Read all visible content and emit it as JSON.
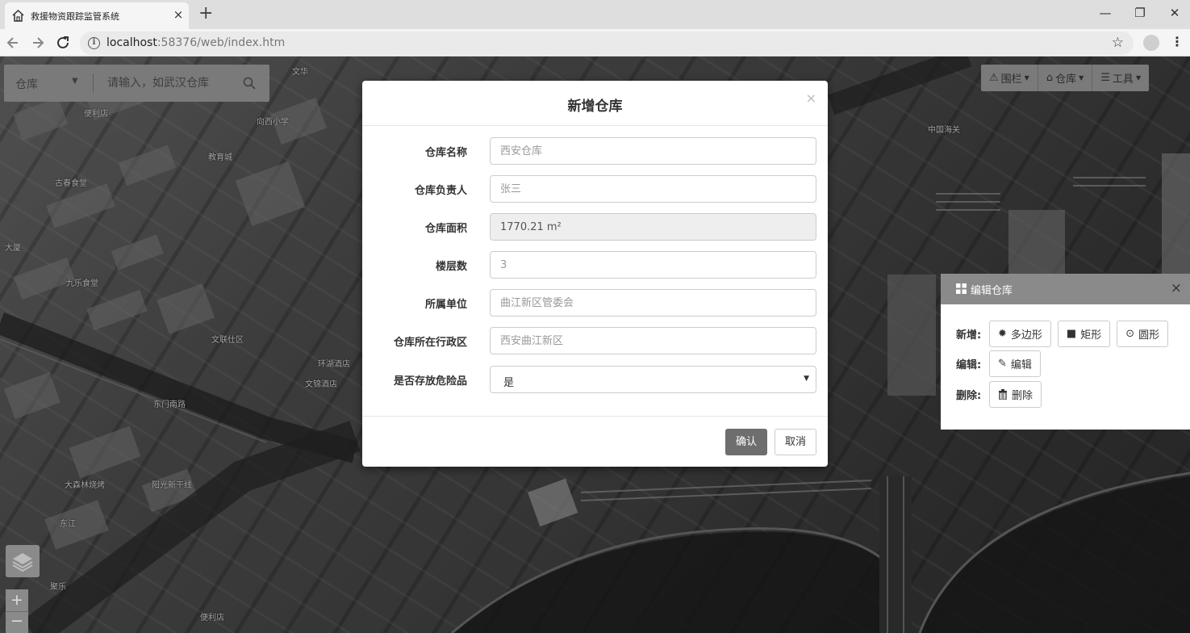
{
  "browser": {
    "tab_title": "救援物资跟踪监管系统",
    "tab_close": "×",
    "new_tab": "+",
    "url_host": "localhost",
    "url_rest": ":58376/web/index.htm",
    "star": "☆",
    "window_minimize": "—",
    "window_maximize": "❐",
    "window_close": "✕"
  },
  "search": {
    "type_label": "仓库",
    "placeholder": "请输入，如武汉仓库"
  },
  "map_toolbar": {
    "fence_label": "围栏",
    "warehouse_label": "仓库",
    "tools_label": "工具"
  },
  "map_labels": [
    "文华",
    "中国海关",
    "向西小学",
    "便利店",
    "教育城",
    "古春食堂",
    "九乐食堂",
    "大厦",
    "文联仕区",
    "环湖酒店",
    "文锦酒店",
    "东门南路",
    "大森林烧烤",
    "阳光新干线",
    "东江",
    "便利店",
    "聚乐"
  ],
  "modal": {
    "title": "新增仓库",
    "close": "×",
    "fields": [
      {
        "label": "仓库名称",
        "placeholder": "西安仓库"
      },
      {
        "label": "仓库负责人",
        "placeholder": "张三"
      },
      {
        "label": "仓库面积",
        "value": "1770.21 m²"
      },
      {
        "label": "楼层数",
        "placeholder": "3"
      },
      {
        "label": "所属单位",
        "placeholder": "曲江新区管委会"
      },
      {
        "label": "仓库所在行政区",
        "placeholder": "西安曲江新区"
      },
      {
        "label": "是否存放危险品",
        "value": "是"
      }
    ],
    "confirm": "确认",
    "cancel": "取消"
  },
  "edit_panel": {
    "title": "编辑仓库",
    "close": "×",
    "add_label": "新增:",
    "polygon": "多边形",
    "rectangle": "矩形",
    "circle": "圆形",
    "edit_label": "编辑:",
    "edit": "编辑",
    "delete_label": "删除:",
    "delete": "删除"
  },
  "map_controls": {
    "zoom_in": "+",
    "zoom_out": "−"
  },
  "colors": {
    "header_gray": "#8a8a8a",
    "confirm_button": "#6e6e6e"
  }
}
